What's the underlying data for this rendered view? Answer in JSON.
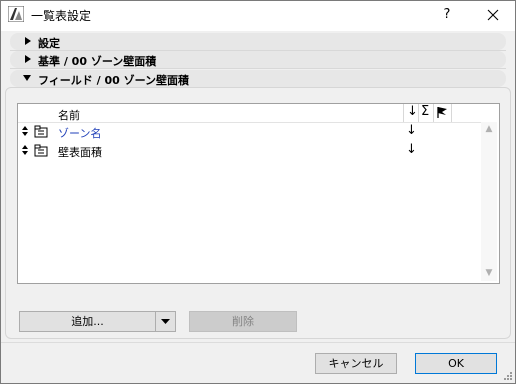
{
  "window": {
    "title": "一覧表設定",
    "help_label": "?"
  },
  "sections": [
    {
      "label": "設定",
      "expanded": false
    },
    {
      "label": "基準 / 00 ゾーン壁面積",
      "expanded": false
    },
    {
      "label": "フィールド / 00 ゾーン壁面積",
      "expanded": true
    }
  ],
  "table": {
    "header_name": "名前",
    "header_sort_icon": "down-arrow",
    "header_sum_label": "Σ",
    "header_flag_icon": "flag-icon",
    "rows": [
      {
        "name": "ゾーン名",
        "color": "#1f3fb8",
        "sort": "↓"
      },
      {
        "name": "壁表面積",
        "color": "#000000",
        "sort": "↓"
      }
    ]
  },
  "buttons": {
    "add_label": "追加...",
    "delete_label": "削除",
    "cancel_label": "キャンセル",
    "ok_label": "OK"
  },
  "colors": {
    "accent": "#0078d7",
    "link_text": "#1f3fb8"
  }
}
